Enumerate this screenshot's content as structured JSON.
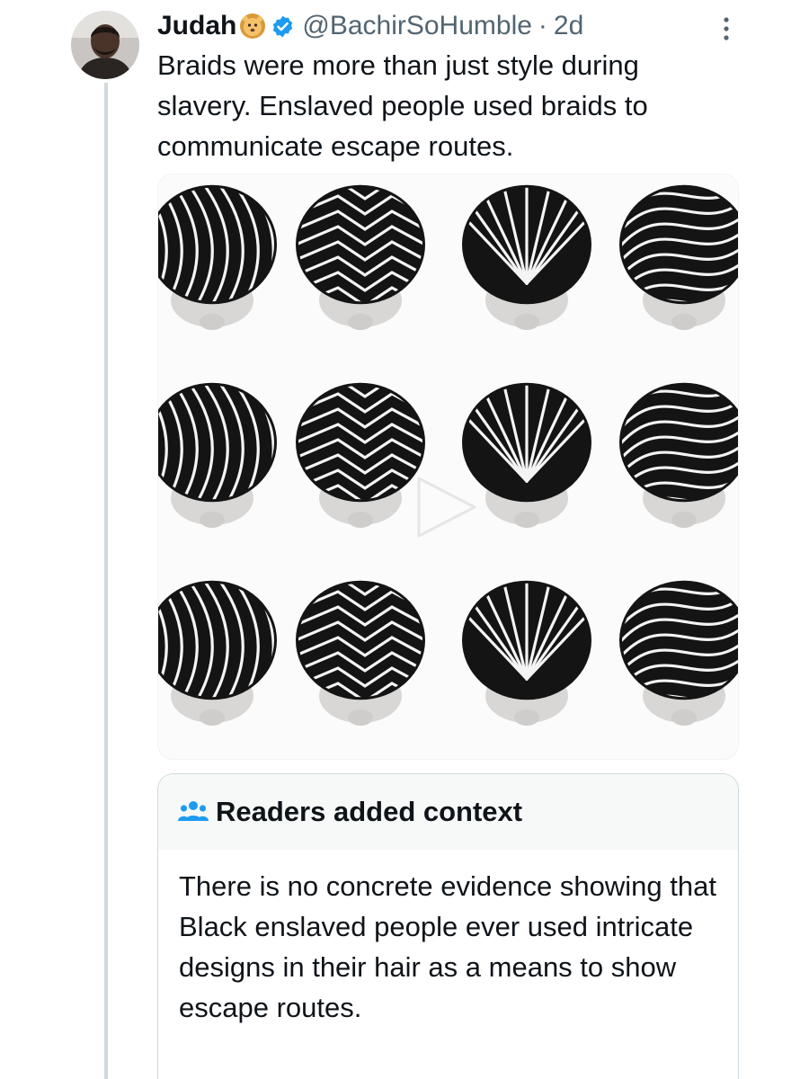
{
  "tweet": {
    "display_name": "Judah",
    "name_emoji": "lion-face-icon",
    "verified_badge": "verified-icon",
    "handle": "@BachirSoHumble",
    "separator": "·",
    "timestamp": "2d",
    "text": "Braids were more than just style during slavery. Enslaved people used braids to communicate escape routes.",
    "more_icon": "more-vertical-icon"
  },
  "media": {
    "type": "video-thumbnail",
    "content": "grid of twelve braided cornrow hairstyles viewed from above, 4 columns by 3 rows",
    "play_icon": "play-icon"
  },
  "community_note": {
    "icon": "people-icon",
    "title": "Readers added context",
    "body": "There is no concrete evidence showing that Black enslaved people ever used intricate designs in their hair as a means to show escape routes."
  },
  "colors": {
    "text_primary": "#0f1419",
    "text_secondary": "#536471",
    "verified_blue": "#1d9bf0",
    "note_icon_blue": "#1d9bf0",
    "border": "#cfd9de",
    "thread_line": "#cfd9de",
    "note_header_bg": "#f7f9f9"
  }
}
